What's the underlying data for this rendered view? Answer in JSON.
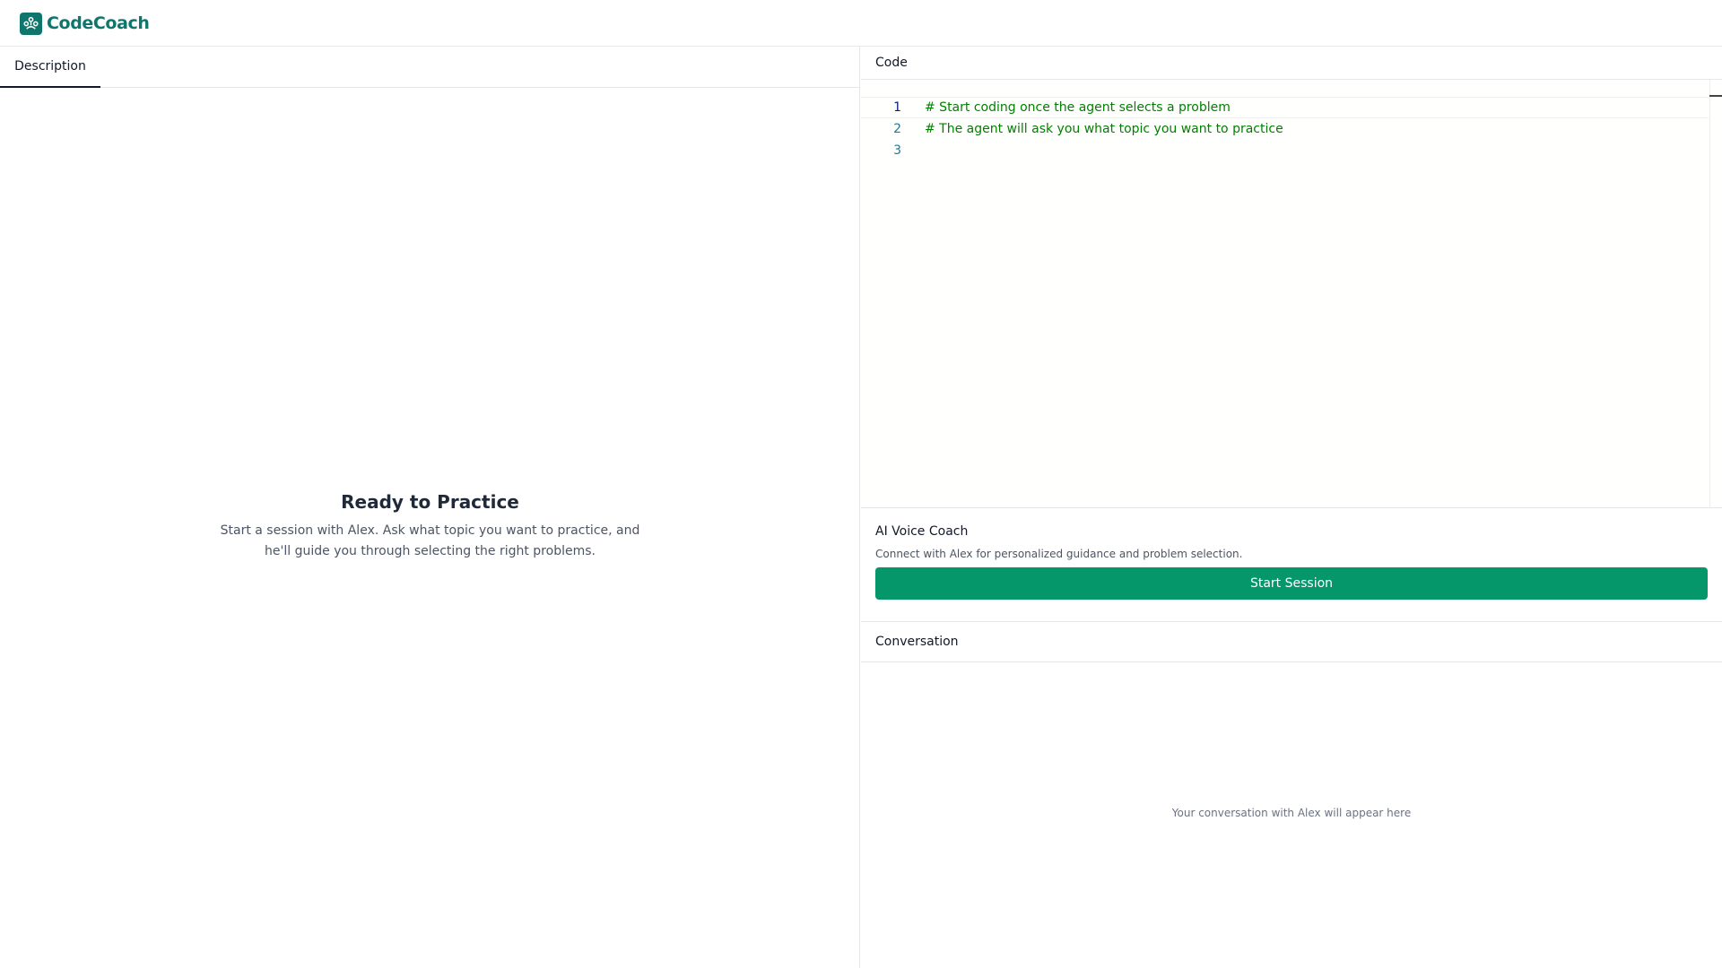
{
  "header": {
    "brand_name": "CodeCoach",
    "logo_icon": "codecoach-logo-icon",
    "brand_color": "#0f766e"
  },
  "left_panel": {
    "tabs": [
      {
        "label": "Description",
        "active": true
      }
    ],
    "empty_state": {
      "title": "Ready to Practice",
      "description": "Start a session with Alex. Ask what topic you want to practice, and he'll guide you through selecting the right problems."
    }
  },
  "code_panel": {
    "title": "Code",
    "lines": [
      {
        "number": "1",
        "text": "# Start coding once the agent selects a problem"
      },
      {
        "number": "2",
        "text": "# The agent will ask you what topic you want to practice"
      },
      {
        "number": "3",
        "text": ""
      }
    ],
    "comment_color": "#008000"
  },
  "voice_coach": {
    "title": "AI Voice Coach",
    "subtitle": "Connect with Alex for personalized guidance and problem selection.",
    "start_button_label": "Start Session",
    "button_color": "#059669"
  },
  "conversation": {
    "title": "Conversation",
    "empty_message": "Your conversation with Alex will appear here"
  }
}
